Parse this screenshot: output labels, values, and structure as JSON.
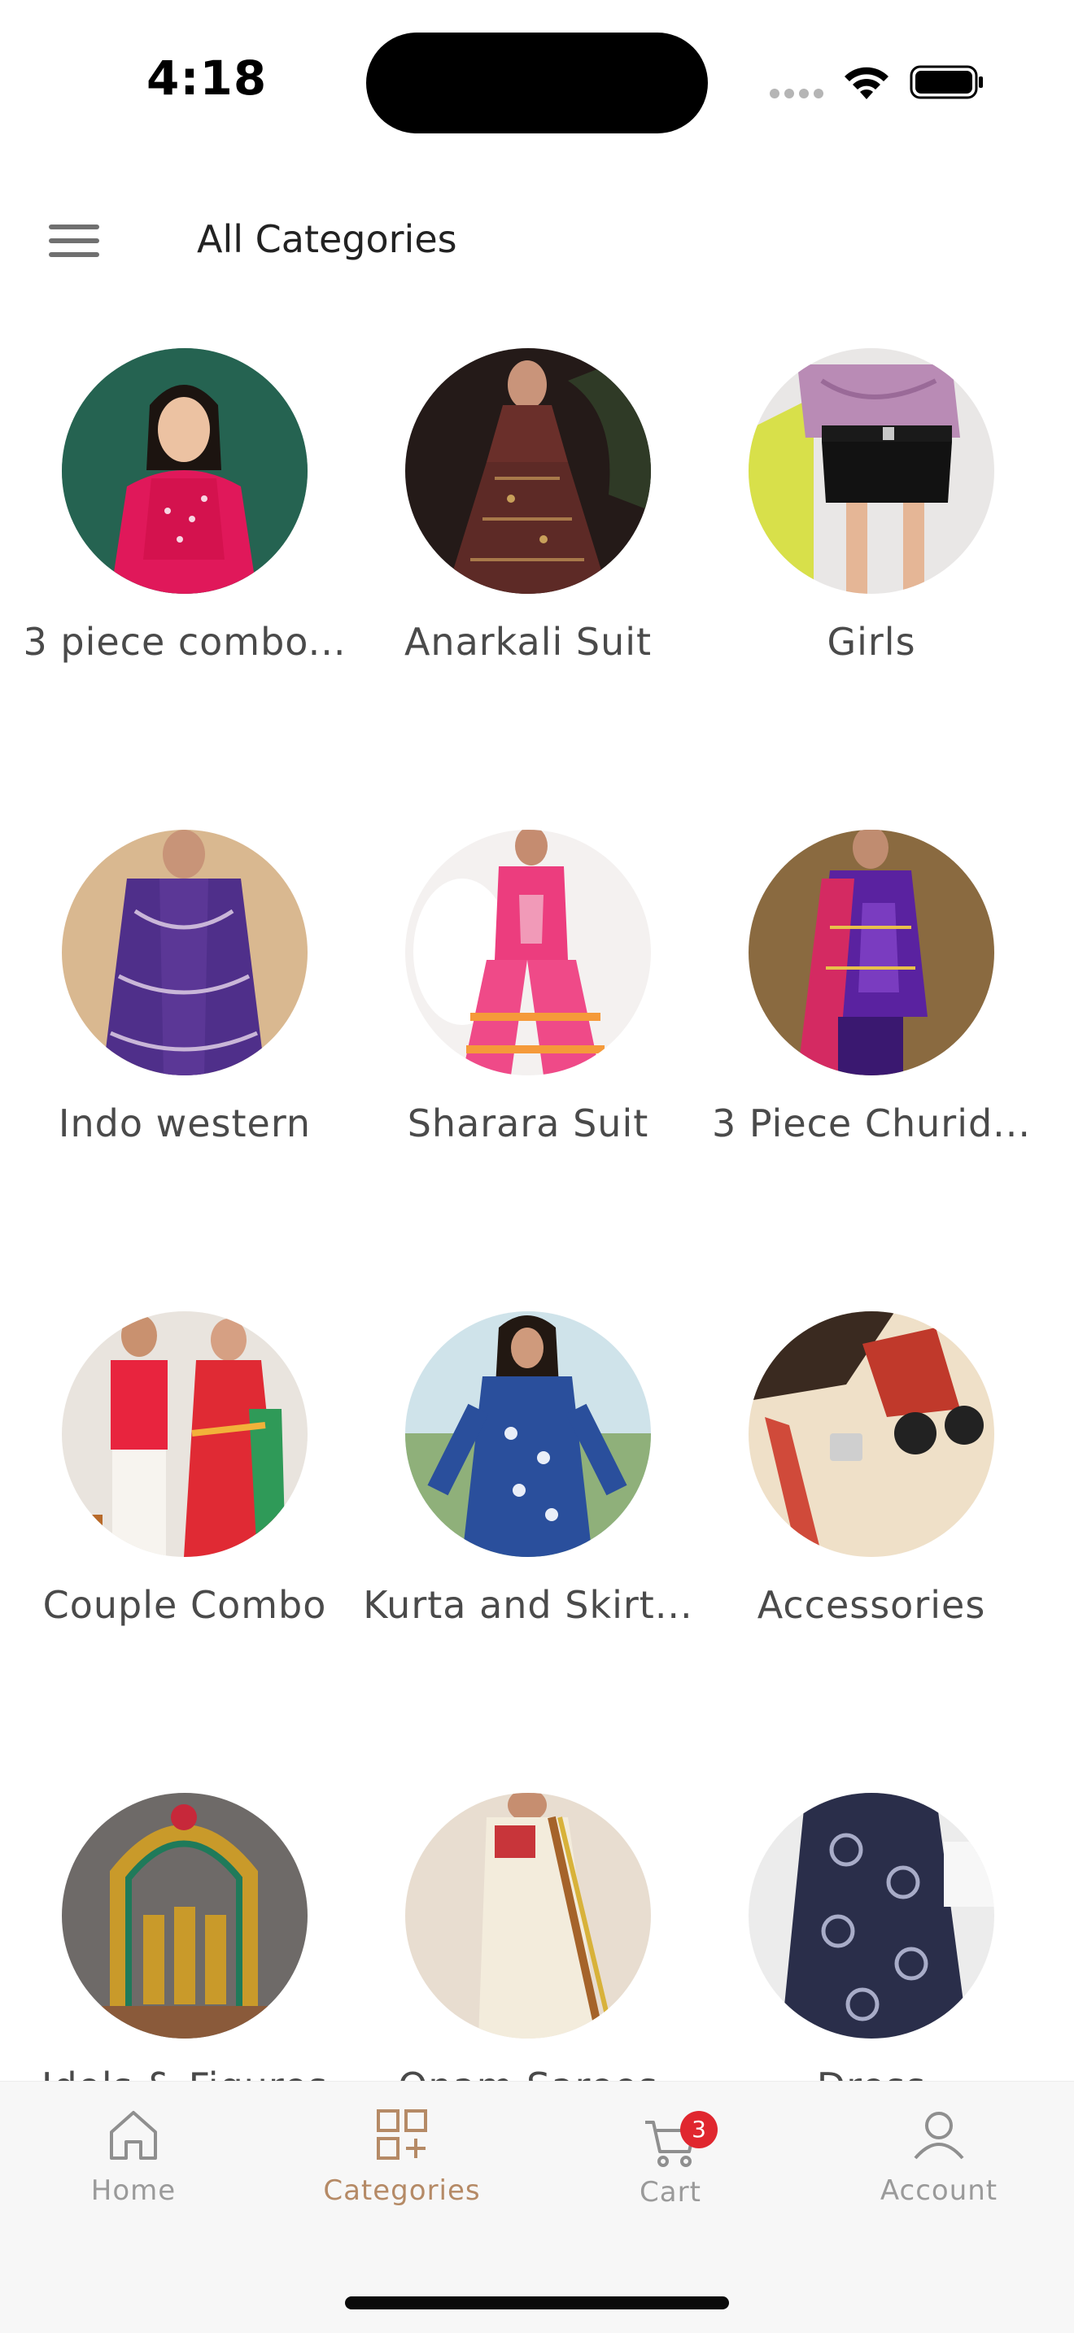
{
  "status": {
    "time": "4:18"
  },
  "header": {
    "title": "All Categories"
  },
  "categories": [
    {
      "label": "3 piece combo...",
      "image": "woman-pink-embroidered-combo"
    },
    {
      "label": "Anarkali Suit",
      "image": "woman-maroon-anarkali"
    },
    {
      "label": "Girls",
      "image": "girl-lilac-top-black-skirt"
    },
    {
      "label": "Indo western",
      "image": "woman-purple-indo-western"
    },
    {
      "label": "Sharara Suit",
      "image": "woman-pink-sharara"
    },
    {
      "label": "3 Piece Churid...",
      "image": "woman-purple-churidar"
    },
    {
      "label": "Couple Combo",
      "image": "couple-red-outfits"
    },
    {
      "label": "Kurta and Skirt...",
      "image": "woman-blue-kurta"
    },
    {
      "label": "Accessories",
      "image": "accessories-flatlay"
    },
    {
      "label": "Idols & Figures",
      "image": "brass-idols"
    },
    {
      "label": "Onam Sarees",
      "image": "cream-saree"
    },
    {
      "label": "Dress",
      "image": "printed-dress"
    }
  ],
  "tabbar": {
    "tabs": [
      {
        "label": "Home",
        "icon": "home-icon",
        "active": false
      },
      {
        "label": "Categories",
        "icon": "categories-icon",
        "active": true
      },
      {
        "label": "Cart",
        "icon": "cart-icon",
        "active": false,
        "badge": "3"
      },
      {
        "label": "Account",
        "icon": "account-icon",
        "active": false
      }
    ]
  },
  "colors": {
    "accent": "#b58a66",
    "badge": "#e0272f",
    "inactive": "#9a9a9a"
  }
}
